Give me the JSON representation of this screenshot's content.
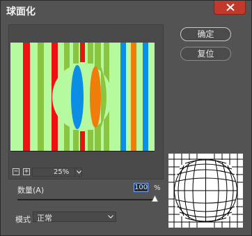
{
  "window": {
    "title": "球面化"
  },
  "buttons": {
    "ok_label": "确定",
    "reset_label": "复位"
  },
  "zoom": {
    "minus": "−",
    "plus": "+",
    "value": "25%"
  },
  "amount": {
    "label": "数量(A)",
    "value": "100",
    "unit": "%",
    "slider_value_fraction": 1.0
  },
  "mode": {
    "label": "模式",
    "value": "正常"
  },
  "icons": {
    "close": "close-icon",
    "zoom_dropdown": "chevron-down-icon",
    "mode_dropdown": "chevron-down-icon",
    "slider_thumb": "triangle-thumb-icon"
  },
  "colors": {
    "stripe_red": "#ee1111",
    "stripe_green": "#8bc53f",
    "stripe_blue": "#0b8ee6",
    "stripe_orange": "#f07d0a",
    "background_light_green": "#b5fa9e",
    "close_button": "#c0392b",
    "input_highlight": "#1e50a2"
  }
}
